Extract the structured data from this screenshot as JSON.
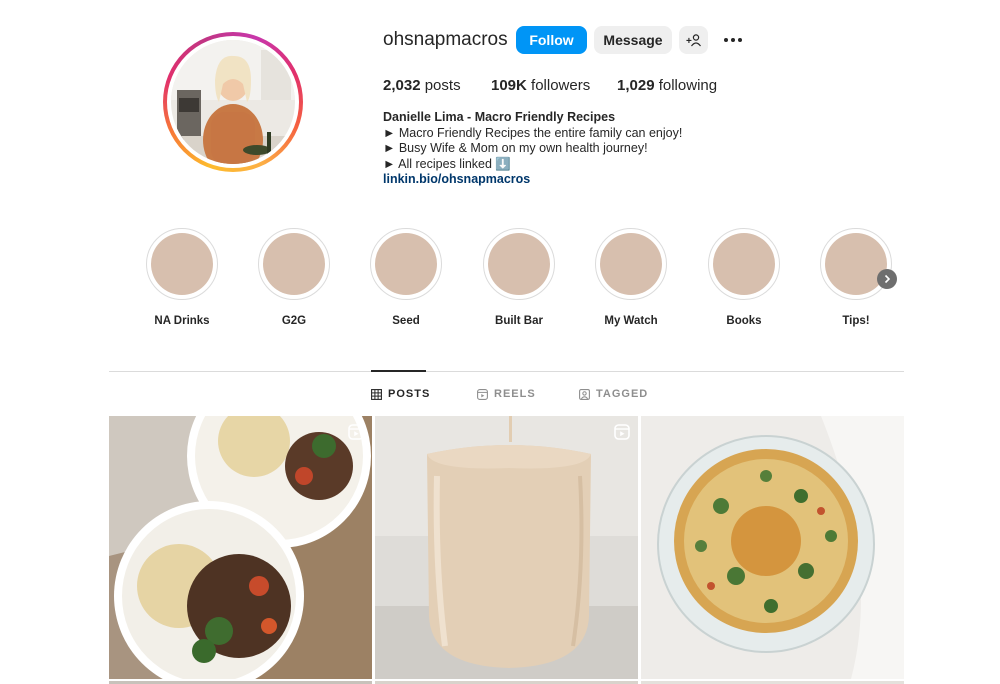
{
  "profile": {
    "username": "ohsnapmacros",
    "follow_label": "Follow",
    "message_label": "Message",
    "suggest_label": "+",
    "stats": {
      "posts_count": "2,032",
      "posts_label": "posts",
      "followers_count": "109K",
      "followers_label": "followers",
      "following_count": "1,029",
      "following_label": "following"
    },
    "bio": {
      "name": "Danielle Lima - Macro Friendly Recipes",
      "line1": "► Macro Friendly Recipes the entire family can enjoy!",
      "line2": "► Busy Wife & Mom on my own health journey!",
      "line3": "► All recipes linked ⬇️",
      "link": "linkin.bio/ohsnapmacros"
    }
  },
  "highlights": [
    {
      "label": "NA Drinks"
    },
    {
      "label": "G2G"
    },
    {
      "label": "Seed"
    },
    {
      "label": "Built Bar"
    },
    {
      "label": "My Watch"
    },
    {
      "label": "Books"
    },
    {
      "label": "Tips!"
    }
  ],
  "tabs": {
    "posts": "POSTS",
    "reels": "REELS",
    "tagged": "TAGGED"
  },
  "posts": [
    {
      "icon": "reel-icon"
    },
    {
      "icon": "reel-icon"
    },
    {
      "icon": "none"
    }
  ],
  "colors": {
    "accent": "#0095f6",
    "link": "#00376b",
    "highlight_fill": "#d7bfae"
  }
}
